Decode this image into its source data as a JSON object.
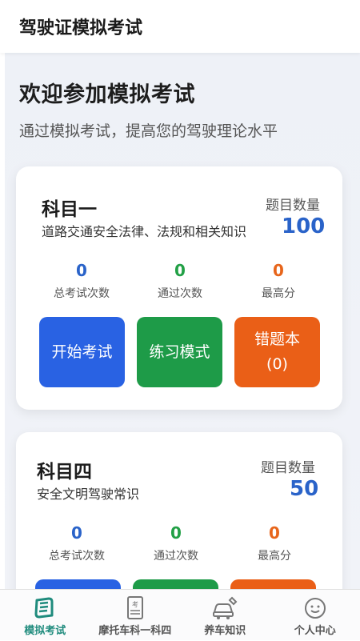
{
  "app_bar": {
    "title": "驾驶证模拟考试"
  },
  "welcome": {
    "title": "欢迎参加模拟考试",
    "subtitle": "通过模拟考试，提高您的驾驶理论水平"
  },
  "subjects": [
    {
      "name": "科目一",
      "description": "道路交通安全法律、法规和相关知识",
      "count_label": "题目数量",
      "count": "100",
      "stats": [
        {
          "value": "0",
          "label": "总考试次数"
        },
        {
          "value": "0",
          "label": "通过次数"
        },
        {
          "value": "0",
          "label": "最高分"
        }
      ],
      "buttons": {
        "start": "开始考试",
        "practice": "练习模式",
        "wrong": "错题本",
        "wrong_count": "(0)"
      }
    },
    {
      "name": "科目四",
      "description": "安全文明驾驶常识",
      "count_label": "题目数量",
      "count": "50",
      "stats": [
        {
          "value": "0",
          "label": "总考试次数"
        },
        {
          "value": "0",
          "label": "通过次数"
        },
        {
          "value": "0",
          "label": "最高分"
        }
      ]
    }
  ],
  "bottom_nav": [
    {
      "label": "模拟考试",
      "icon": "book-icon",
      "active": true
    },
    {
      "label": "摩托车科一科四",
      "icon": "exam-paper-icon",
      "active": false
    },
    {
      "label": "养车知识",
      "icon": "car-wrench-icon",
      "active": false
    },
    {
      "label": "个人中心",
      "icon": "face-icon",
      "active": false
    }
  ],
  "colors": {
    "accent_blue": "#2962e3",
    "accent_green": "#1e9b48",
    "accent_orange": "#ea5f17",
    "nav_active": "#1f8b7d"
  }
}
